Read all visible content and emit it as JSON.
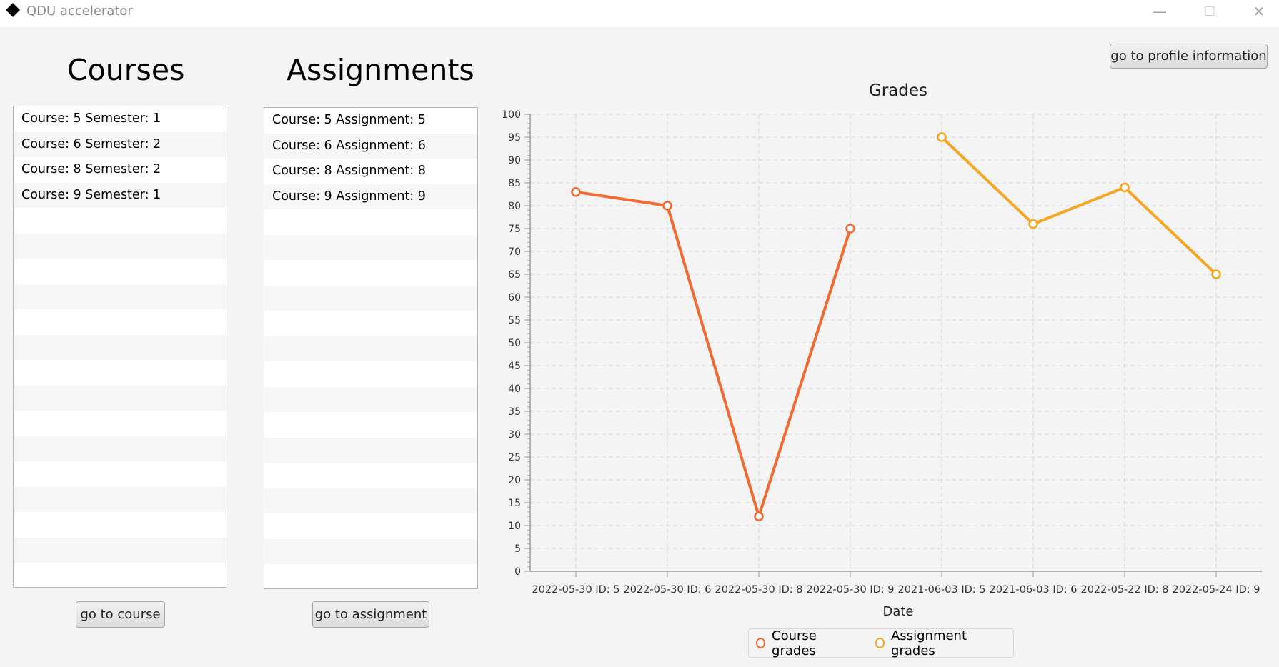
{
  "window": {
    "title": "QDU accelerator",
    "minimize": "—",
    "maximize": "☐",
    "close": "✕"
  },
  "courses": {
    "heading": "Courses",
    "items": [
      "Course: 5 Semester: 1",
      "Course: 6 Semester: 2",
      "Course: 8 Semester: 2",
      "Course: 9 Semester: 1"
    ],
    "button": "go to course"
  },
  "assignments": {
    "heading": "Assignments",
    "items": [
      "Course: 5 Assignment: 5",
      "Course: 6 Assignment: 6",
      "Course: 8 Assignment: 8",
      "Course: 9 Assignment: 9"
    ],
    "button": "go to assignment"
  },
  "profile_button": "go to profile information",
  "chart_data": {
    "type": "line",
    "title": "Grades",
    "xlabel": "Date",
    "ylabel": "",
    "ylim": [
      0,
      100
    ],
    "ytick_step": 5,
    "grid": true,
    "legend_position": "bottom",
    "categories": [
      "2022-05-30 ID: 5",
      "2022-05-30 ID: 6",
      "2022-05-30 ID: 8",
      "2022-05-30 ID: 9",
      "2021-06-03 ID: 5",
      "2021-06-03 ID: 6",
      "2022-05-22 ID: 8",
      "2022-05-24 ID: 9"
    ],
    "series": [
      {
        "name": "Course grades",
        "color": "#f06a32",
        "points": [
          [
            0,
            83
          ],
          [
            1,
            80
          ],
          [
            2,
            12
          ],
          [
            3,
            75
          ]
        ]
      },
      {
        "name": "Assignment grades",
        "color": "#f5a623",
        "points": [
          [
            4,
            95
          ],
          [
            5,
            76
          ],
          [
            6,
            84
          ],
          [
            7,
            65
          ]
        ]
      }
    ]
  }
}
